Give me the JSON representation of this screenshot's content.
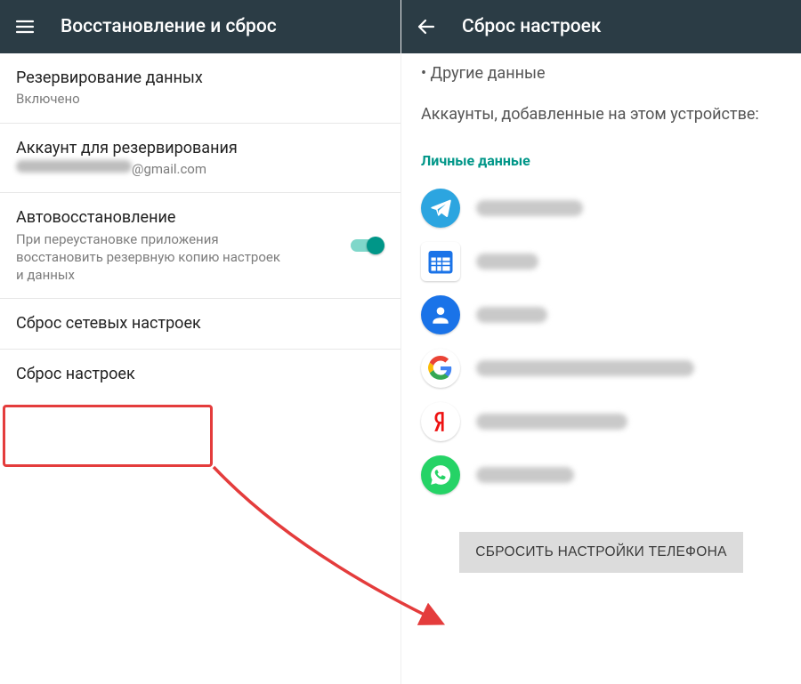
{
  "left": {
    "title": "Восстановление и сброс",
    "items": {
      "backup": {
        "title": "Резервирование данных",
        "subtitle": "Включено"
      },
      "account": {
        "title": "Аккаунт для резервирования",
        "subtitle_suffix": "@gmail.com"
      },
      "autorestore": {
        "title": "Автовосстановление",
        "subtitle": "При переустановке приложения восстановить резервную копию настроек и данных",
        "switch_on": true
      },
      "network_reset": {
        "title": "Сброс сетевых настроек"
      },
      "factory_reset": {
        "title": "Сброс настроек"
      }
    }
  },
  "right": {
    "title": "Сброс настроек",
    "bullet_other_data": "Другие данные",
    "accounts_intro": "Аккаунты, добавленные на этом устройстве:",
    "section_personal": "Личные данные",
    "accounts": [
      {
        "name": "telegram",
        "blur_w": 120
      },
      {
        "name": "calendar",
        "blur_w": 70
      },
      {
        "name": "contacts",
        "blur_w": 80
      },
      {
        "name": "google",
        "blur_w": 245
      },
      {
        "name": "yandex",
        "blur_w": 170
      },
      {
        "name": "whatsapp",
        "blur_w": 110
      }
    ],
    "reset_button": "СБРОСИТЬ НАСТРОЙКИ ТЕЛЕФОНА"
  }
}
